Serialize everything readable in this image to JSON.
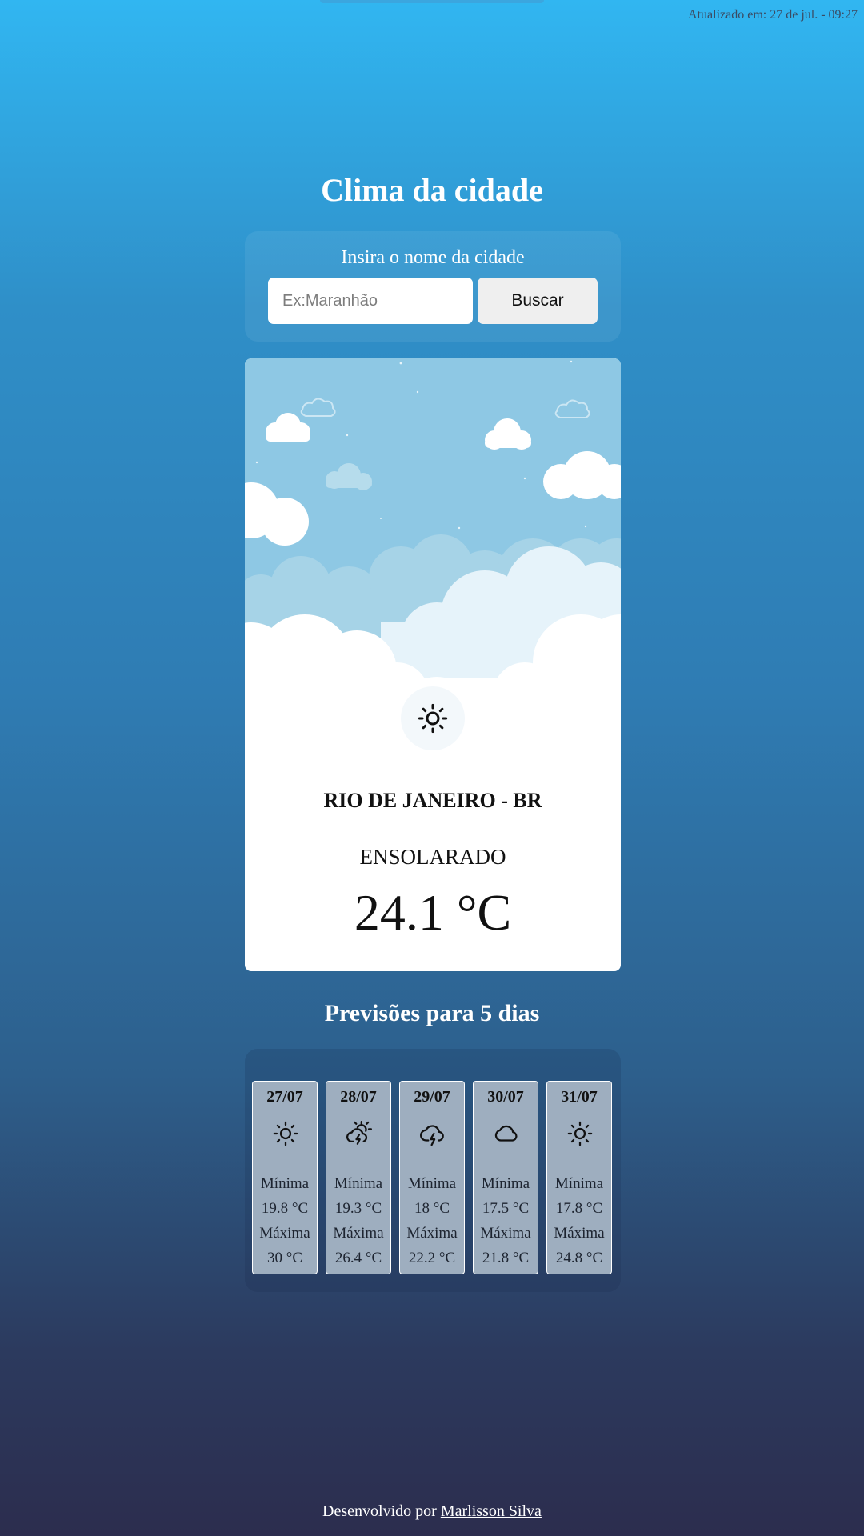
{
  "updated_text": "Atualizado em: 27 de jul. - 09:27",
  "title": "Clima da cidade",
  "search": {
    "label": "Insira o nome da cidade",
    "placeholder": "Ex:Maranhão",
    "value": "",
    "button": "Buscar"
  },
  "current": {
    "city": "RIO DE JANEIRO - BR",
    "condition": "ENSOLARADO",
    "temperature": "24.1 °C",
    "icon": "sun-icon"
  },
  "forecast": {
    "title": "Previsões para 5 dias",
    "min_label": "Mínima",
    "max_label": "Máxima",
    "days": [
      {
        "date": "27/07",
        "icon": "sun-icon",
        "min": "19.8 °C",
        "max": "30 °C"
      },
      {
        "date": "28/07",
        "icon": "sun-storm-icon",
        "min": "19.3 °C",
        "max": "26.4 °C"
      },
      {
        "date": "29/07",
        "icon": "storm-cloud-icon",
        "min": "18 °C",
        "max": "22.2 °C"
      },
      {
        "date": "30/07",
        "icon": "cloud-icon",
        "min": "17.5 °C",
        "max": "21.8 °C"
      },
      {
        "date": "31/07",
        "icon": "sun-icon",
        "min": "17.8 °C",
        "max": "24.8 °C"
      }
    ]
  },
  "footer": {
    "prefix": "Desenvolvido por",
    "author": "Marlisson Silva"
  }
}
